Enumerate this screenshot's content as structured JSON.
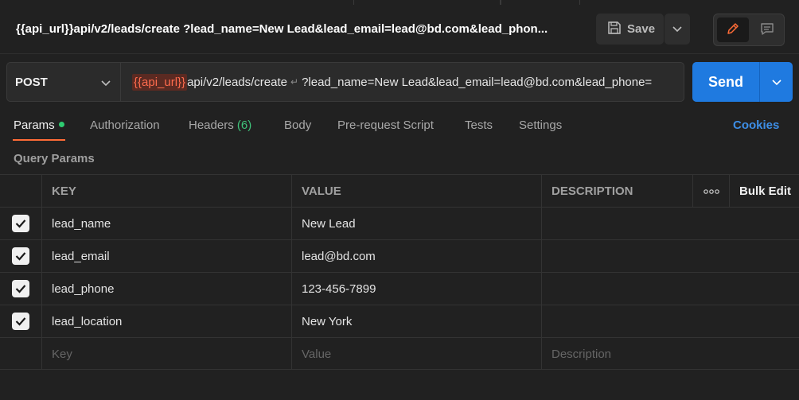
{
  "request": {
    "title": "{{api_url}}api/v2/leads/create ?lead_name=New Lead&lead_email=lead@bd.com&lead_phon...",
    "save_label": "Save",
    "method": "POST",
    "url_variable": "{{api_url}}",
    "url_path": "api/v2/leads/create",
    "url_query": "?lead_name=New Lead&lead_email=lead@bd.com&lead_phone=",
    "send_label": "Send"
  },
  "tabs": [
    {
      "label": "Params"
    },
    {
      "label": "Authorization"
    },
    {
      "label": "Headers",
      "count": "(6)"
    },
    {
      "label": "Body"
    },
    {
      "label": "Pre-request Script"
    },
    {
      "label": "Tests"
    },
    {
      "label": "Settings"
    }
  ],
  "cookies_label": "Cookies",
  "section_label": "Query Params",
  "table": {
    "headers": {
      "key": "KEY",
      "value": "VALUE",
      "description": "DESCRIPTION",
      "more": "ooo",
      "bulk": "Bulk Edit"
    },
    "rows": [
      {
        "key": "lead_name",
        "value": "New Lead",
        "checked": true
      },
      {
        "key": "lead_email",
        "value": "lead@bd.com",
        "checked": true
      },
      {
        "key": "lead_phone",
        "value": "123-456-7899",
        "checked": true
      },
      {
        "key": "lead_location",
        "value": "New York",
        "checked": true
      }
    ],
    "placeholders": {
      "key": "Key",
      "value": "Value",
      "description": "Description"
    }
  },
  "colors": {
    "accent": "#ff6c37",
    "send": "#1f7ae0",
    "cookies": "#3d8ee6",
    "variable": "#ff6b4d",
    "active_dot": "#2ecc71"
  }
}
